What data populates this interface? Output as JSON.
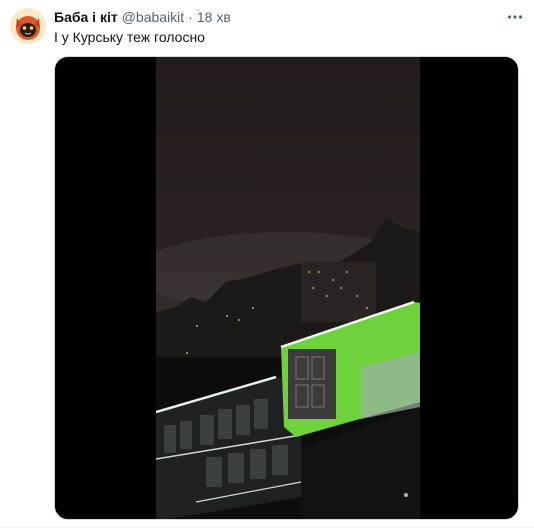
{
  "tweet": {
    "author": {
      "display_name": "Баба і кіт",
      "handle": "@babaikit",
      "avatar_icon": "cat-face-avatar"
    },
    "separator": "·",
    "time": "18 хв",
    "text": "І у Курську теж голосно",
    "more_icon": "more-horizontal-icon",
    "media": {
      "type": "video",
      "scene": "night-city-buildings"
    }
  },
  "colors": {
    "text_primary": "#0f1419",
    "text_secondary": "#536471",
    "media_bg": "#000000",
    "building_green": "#7ee04a"
  }
}
